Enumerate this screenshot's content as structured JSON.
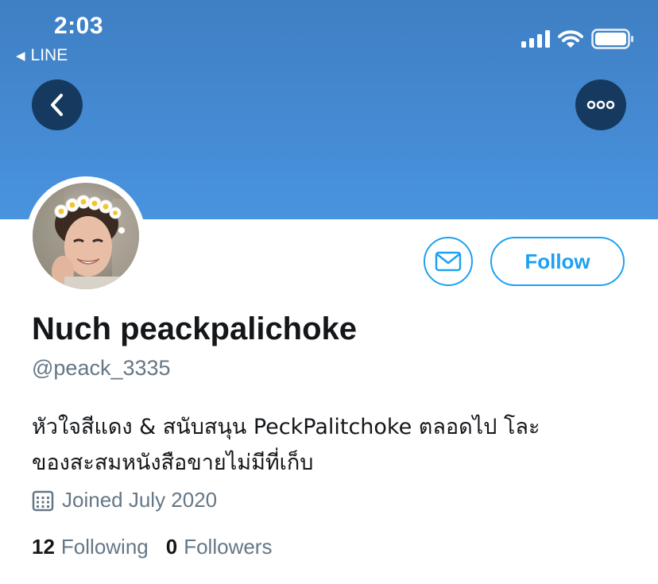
{
  "status_bar": {
    "time": "2:03",
    "back_app_label": "LINE",
    "icons": [
      "signal-icon",
      "wifi-icon",
      "battery-icon"
    ]
  },
  "header": {
    "back_icon": "chevron-left-icon",
    "more_icon": "more-icon",
    "banner_color": "#4993df"
  },
  "actions": {
    "message_icon": "mail-icon",
    "follow_label": "Follow",
    "accent_color": "#1da1f2"
  },
  "profile": {
    "name": "Nuch peackpalichoke",
    "handle": "@peack_3335",
    "bio_line1": "หัวใจสีแดง & สนับสนุน PeckPalitchoke ตลอดไป โละ",
    "bio_line2": "ของสะสมหนังสือขายไม่มีที่เก็บ",
    "joined": "Joined July 2020",
    "following_count": "12",
    "following_label": "Following",
    "followers_count": "0",
    "followers_label": "Followers"
  }
}
